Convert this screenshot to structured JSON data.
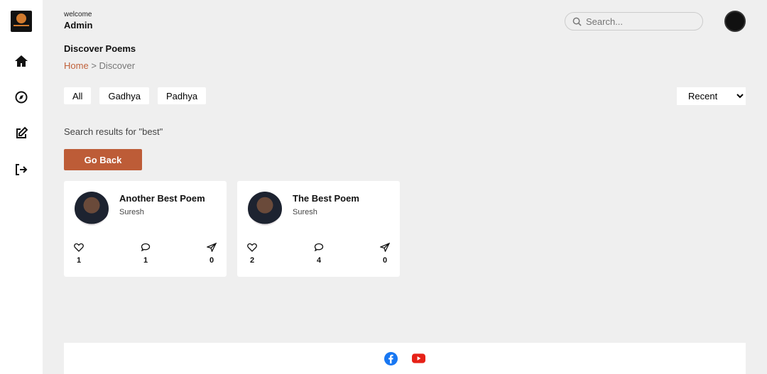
{
  "header": {
    "welcome": "welcome",
    "user": "Admin",
    "search_placeholder": "Search..."
  },
  "page": {
    "title": "Discover Poems",
    "breadcrumb": {
      "home": "Home",
      "separator": ">",
      "current": "Discover"
    }
  },
  "filters": [
    "All",
    "Gadhya",
    "Padhya"
  ],
  "sort": {
    "selected": "Recent"
  },
  "results_text": "Search results for \"best\"",
  "go_back": "Go Back",
  "poems": [
    {
      "title": "Another Best Poem",
      "author": "Suresh",
      "likes": "1",
      "comments": "1",
      "shares": "0"
    },
    {
      "title": "The Best Poem",
      "author": "Suresh",
      "likes": "2",
      "comments": "4",
      "shares": "0"
    }
  ],
  "colors": {
    "accent": "#bd5c37",
    "facebook": "#1877f2",
    "youtube": "#e62117"
  }
}
